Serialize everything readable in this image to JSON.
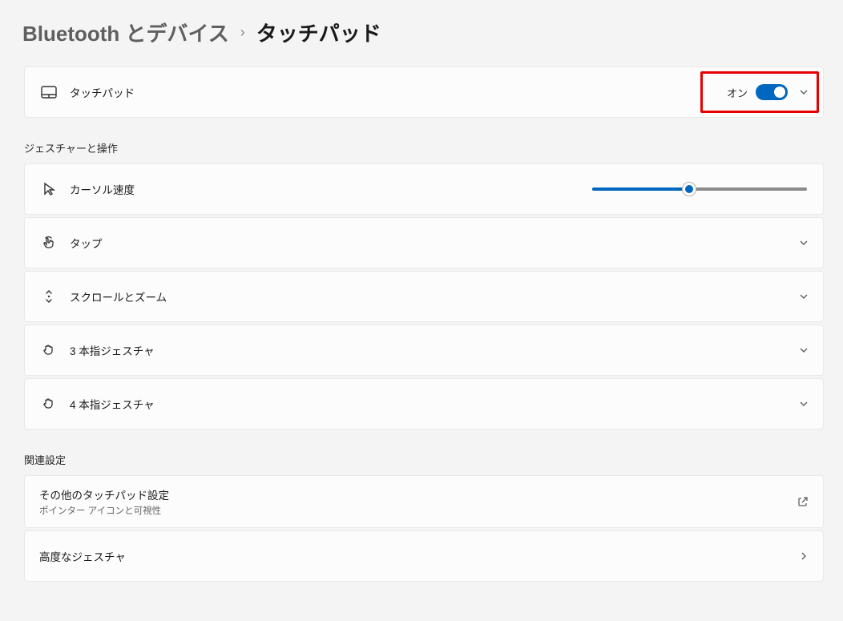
{
  "breadcrumb": {
    "parent": "Bluetooth とデバイス",
    "separator": "›",
    "current": "タッチパッド"
  },
  "touchpad_card": {
    "label": "タッチパッド",
    "toggle_state_label": "オン",
    "toggle_on": true
  },
  "section_gestures_title": "ジェスチャーと操作",
  "rows": {
    "cursor_speed": {
      "label": "カーソル速度",
      "slider_value_percent": 45
    },
    "tap": {
      "label": "タップ"
    },
    "scroll_zoom": {
      "label": "スクロールとズーム"
    },
    "three_finger": {
      "label": "3 本指ジェスチャ"
    },
    "four_finger": {
      "label": "4 本指ジェスチャ"
    }
  },
  "section_related_title": "関連設定",
  "related": {
    "other_touchpad": {
      "label": "その他のタッチパッド設定",
      "sublabel": "ポインター アイコンと可視性"
    },
    "advanced_gestures": {
      "label": "高度なジェスチャ"
    }
  }
}
